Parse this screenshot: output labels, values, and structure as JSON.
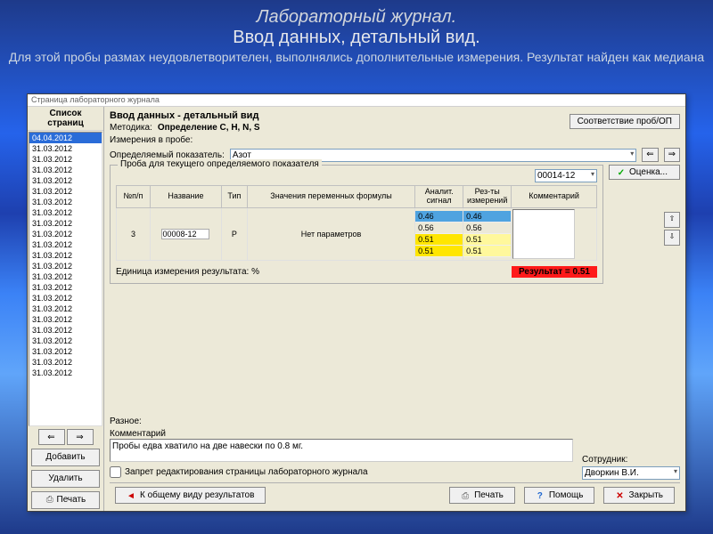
{
  "slide": {
    "title1": "Лабораторный журнал.",
    "title2": "Ввод данных, детальный вид.",
    "subtitle": "Для этой пробы размах неудовлетворителен, выполнялись дополнительные измерения. Результат найден как медиана"
  },
  "window": {
    "title": "Страница лабораторного журнала"
  },
  "sidebar": {
    "header_l1": "Список",
    "header_l2": "страниц",
    "selected": "04.04.2012",
    "pages": [
      "31.03.2012",
      "31.03.2012",
      "31.03.2012",
      "31.03.2012",
      "31.03.2012",
      "31.03.2012",
      "31.03.2012",
      "31.03.2012",
      "31.03.2012",
      "31.03.2012",
      "31.03.2012",
      "31.03.2012",
      "31.03.2012",
      "31.03.2012",
      "31.03.2012",
      "31.03.2012",
      "31.03.2012",
      "31.03.2012",
      "31.03.2012",
      "31.03.2012",
      "31.03.2012",
      "31.03.2012"
    ],
    "nav_prev": "⇐",
    "nav_next": "⇒",
    "add": "Добавить",
    "delete": "Удалить",
    "print": "Печать"
  },
  "main": {
    "section_title": "Ввод данных - детальный вид",
    "method_lbl": "Методика:",
    "method_val": "Определение C, H, N, S",
    "corr_btn": "Соответствие проб/ОП",
    "meas_lbl": "Измерения в пробе:",
    "indicator_lbl": "Определяемый показатель:",
    "indicator_val": "Азот",
    "arrow_l": "⇐",
    "arrow_r": "⇒",
    "fieldset_legend": "Проба для текущего определяемого показателя",
    "sample_code": "00014-12",
    "evaluate_btn": "Оценка...",
    "cols": {
      "n": "№п/п",
      "name": "Название",
      "type": "Тип",
      "formula": "Значения переменных формулы",
      "signal": "Аналит. сигнал",
      "result": "Рез-ты измерений",
      "comment": "Комментарий"
    },
    "row": {
      "n": "3",
      "name": "00008-12",
      "type": "Р",
      "formula": "Нет параметров",
      "signals": [
        "0.46",
        "0.56",
        "0.51",
        "0.51"
      ],
      "results": [
        "0.46",
        "0.56",
        "0.51",
        "0.51"
      ]
    },
    "unit_lbl": "Единица измерения результата:",
    "unit_val": "%",
    "result_badge": "Результат = 0.51",
    "misc_lbl": "Разное:",
    "comment_lbl": "Комментарий",
    "comment_val": "Пробы едва хватило на две навески по 0.8 мг.",
    "lock_lbl": "Запрет редактирования страницы лабораторного журнала",
    "employee_lbl": "Сотрудник:",
    "employee_val": "Дворкин В.И."
  },
  "bottom": {
    "to_overview": "К общему виду результатов",
    "print": "Печать",
    "help": "Помощь",
    "close": "Закрыть"
  }
}
